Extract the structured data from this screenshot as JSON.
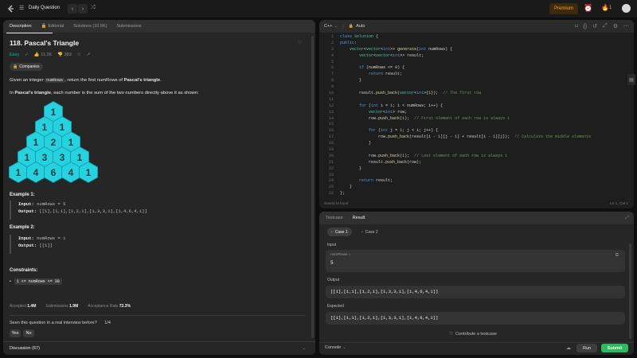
{
  "topbar": {
    "list_title": "Daily Question",
    "premium": "Premium",
    "streak": "1"
  },
  "left": {
    "tabs": [
      "Description",
      "Editorial",
      "Solutions (10.5K)",
      "Submissions"
    ],
    "title": "118. Pascal's Triangle",
    "difficulty": "Easy",
    "likes": "11.2K",
    "dislikes": "383",
    "companies": "Companies",
    "desc_prefix": "Given an integer ",
    "desc_code": "numRows",
    "desc_mid": ", return the first numRows of ",
    "desc_bold": "Pascal's triangle",
    "desc_end": ".",
    "desc2_bold": "Pascal's triangle",
    "desc2_rest": ", each number is the sum of the two numbers directly above it as shown:",
    "desc2_prefix": "In ",
    "triangle": [
      [
        "1"
      ],
      [
        "1",
        "1"
      ],
      [
        "1",
        "2",
        "1"
      ],
      [
        "1",
        "3",
        "3",
        "1"
      ],
      [
        "1",
        "4",
        "6",
        "4",
        "1"
      ]
    ],
    "ex1_title": "Example 1:",
    "ex1_input_label": "Input:",
    "ex1_input": "numRows = 5",
    "ex1_output_label": "Output:",
    "ex1_output": "[[1],[1,1],[1,2,1],[1,3,3,1],[1,4,6,4,1]]",
    "ex2_title": "Example 2:",
    "ex2_input_label": "Input:",
    "ex2_input": "numRows = 1",
    "ex2_output_label": "Output:",
    "ex2_output": "[[1]]",
    "constraints_title": "Constraints:",
    "constraint": "1 <= numRows <= 30",
    "accepted_label": "Accepted",
    "accepted": "1.4M",
    "submissions_label": "Submissions",
    "submissions": "1.9M",
    "rate_label": "Acceptance Rate",
    "rate": "72.3%",
    "interview_q": "Seen this question in a real interview before?",
    "interview_page": "1/4",
    "yes": "Yes",
    "no": "No",
    "discussion": "Discussion (67)"
  },
  "editor": {
    "lang": "C++",
    "auto": "Auto",
    "lines": [
      "class Solution {",
      "public:",
      "    vector<vector<int>> generate(int numRows) {",
      "        vector<vector<int>> result;",
      "",
      "        if (numRows <= 0) {",
      "            return result;",
      "        }",
      "",
      "        result.push_back(vector<int>{1});  // The first row",
      "",
      "        for (int i = 1; i < numRows; i++) {",
      "            vector<int> row;",
      "            row.push_back(1);  // First element of each row is always 1",
      "",
      "            for (int j = 1; j < i; j++) {",
      "                row.push_back(result[i - 1][j - 1] + result[i - 1][j]);  // Calculate the middle elements",
      "            }",
      "",
      "            row.push_back(1);  // Last element of each row is always 1",
      "            result.push_back(row);",
      "        }",
      "",
      "        return result;",
      "    }",
      "};"
    ],
    "saved": "Saved to local",
    "cursor": "Ln 1, Col 1"
  },
  "testpanel": {
    "tabs": [
      "Testcase",
      "Result"
    ],
    "cases": [
      "Case 1",
      "Case 2"
    ],
    "input_label": "Input",
    "var_label": "numRows =",
    "var_value": "5",
    "output_label": "Output",
    "output_value": "[[1],[1,1],[1,2,1],[1,3,3,1],[1,4,6,4,1]]",
    "expected_label": "Expected",
    "expected_value": "[[1],[1,1],[1,2,1],[1,3,3,1],[1,4,6,4,1]]",
    "contribute": "Contribute a testcase",
    "console": "Console",
    "run": "Run",
    "submit": "Submit"
  },
  "colors": {
    "accent": "#ffa116",
    "easy": "#00b8a3",
    "submit": "#2cbb5d",
    "hex": "#25d3e0"
  }
}
